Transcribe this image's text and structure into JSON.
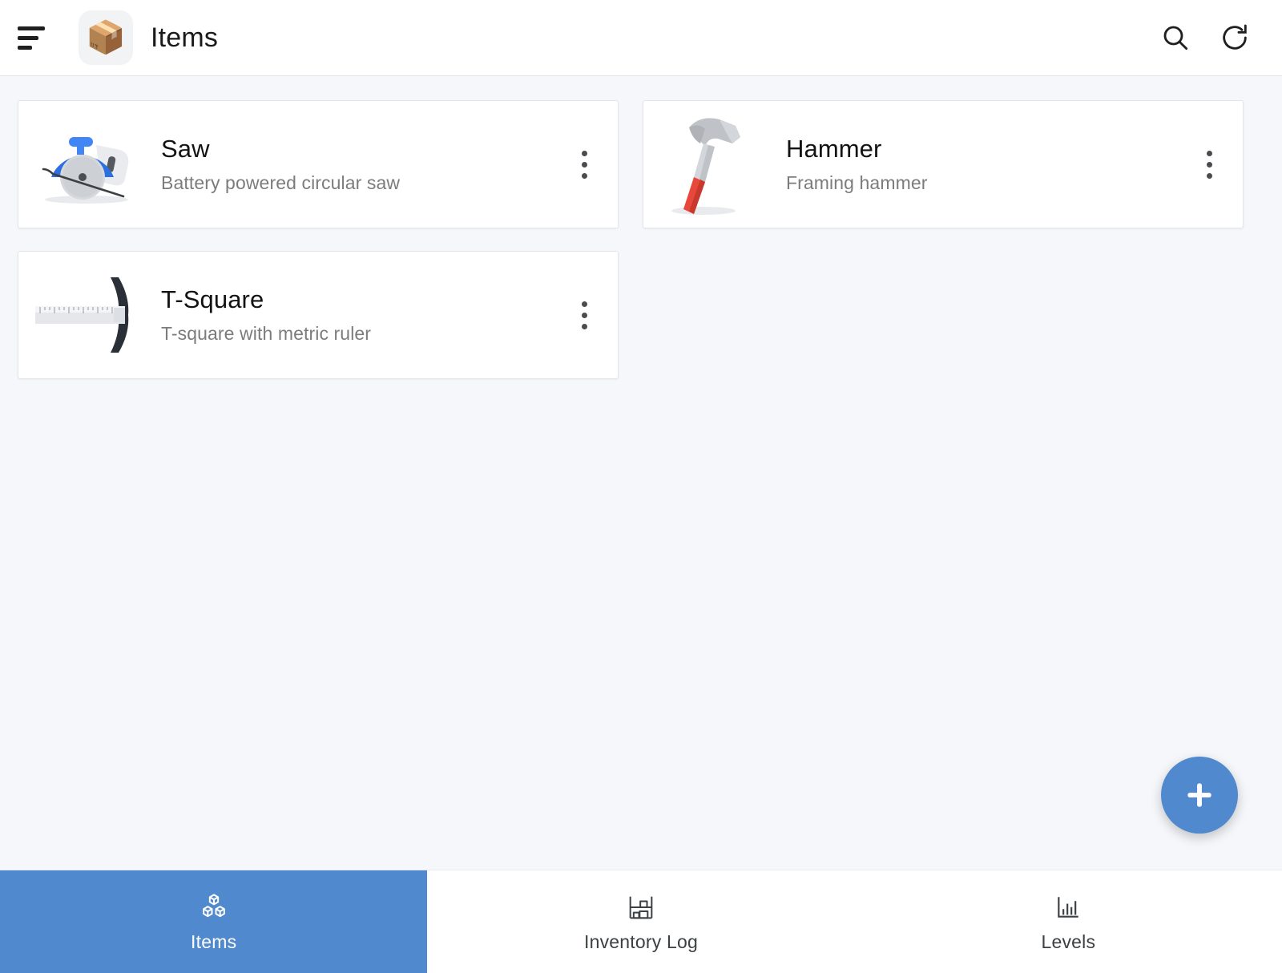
{
  "header": {
    "menu_icon": "hamburger-menu-icon",
    "app_icon": "package-box-icon",
    "app_icon_glyph": "📦",
    "title": "Items",
    "actions": [
      {
        "name": "search-icon",
        "label": "Search"
      },
      {
        "name": "refresh-icon",
        "label": "Refresh"
      }
    ]
  },
  "items": [
    {
      "title": "Saw",
      "subtitle": "Battery powered circular saw",
      "icon": "circular-saw-icon",
      "menu_icon": "more-vertical-icon"
    },
    {
      "title": "Hammer",
      "subtitle": "Framing hammer",
      "icon": "hammer-icon",
      "menu_icon": "more-vertical-icon"
    },
    {
      "title": "T-Square",
      "subtitle": "T-square with metric ruler",
      "icon": "t-square-icon",
      "menu_icon": "more-vertical-icon"
    }
  ],
  "fab": {
    "icon": "plus-icon",
    "label": "Add item"
  },
  "bottom_nav": {
    "active_index": 0,
    "tabs": [
      {
        "label": "Items",
        "icon": "boxes-icon"
      },
      {
        "label": "Inventory Log",
        "icon": "warehouse-shelf-icon"
      },
      {
        "label": "Levels",
        "icon": "bar-chart-icon"
      }
    ]
  },
  "colors": {
    "accent": "#5089CE",
    "page_background": "#F5F7FA",
    "card_background": "#FFFFFF",
    "card_border": "#E2E5E9",
    "title_text": "#131313",
    "subtitle_text": "#7C7C7C"
  }
}
